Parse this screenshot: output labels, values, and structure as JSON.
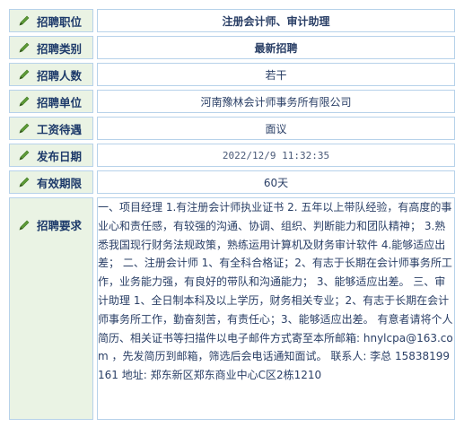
{
  "rows": [
    {
      "label": "招聘职位",
      "value": "注册会计师、审计助理"
    },
    {
      "label": "招聘类别",
      "value": "最新招聘"
    },
    {
      "label": "招聘人数",
      "value": "若干"
    },
    {
      "label": "招聘单位",
      "value": "河南豫林会计师事务所有限公司"
    },
    {
      "label": "工资待遇",
      "value": "面议"
    },
    {
      "label": "发布日期",
      "value": "2022/12/9 11:32:35"
    },
    {
      "label": "有效期限",
      "value": "60天"
    }
  ],
  "requirements": {
    "label": "招聘要求",
    "text": "一、项目经理 1.有注册会计师执业证书 2. 五年以上带队经验，有高度的事业心和责任感，有较强的沟通、协调、组织、判断能力和团队精神； 3.熟悉我国现行财务法规政策，熟练运用计算机及财务审计软件 4.能够适应出差； 二、注册会计师 1、有全科合格证；2、有志于长期在会计师事务所工作，业务能力强，有良好的带队和沟通能力； 3、能够适应出差。 三、审计助理 1、全日制本科及以上学历，财务相关专业；2、有志于长期在会计师事务所工作，勤奋刻苦，有责任心；3、能够适应出差。 有意者请将个人简历、相关证书等扫描件以电子邮件方式寄至本所邮箱: hnylcpa@163.com ，先发简历到邮箱，筛选后会电话通知面试。 联系人: 李总 15838199161 地址: 郑东新区郑东商业中心C区2栋1210"
  },
  "icon": "pencil-icon"
}
